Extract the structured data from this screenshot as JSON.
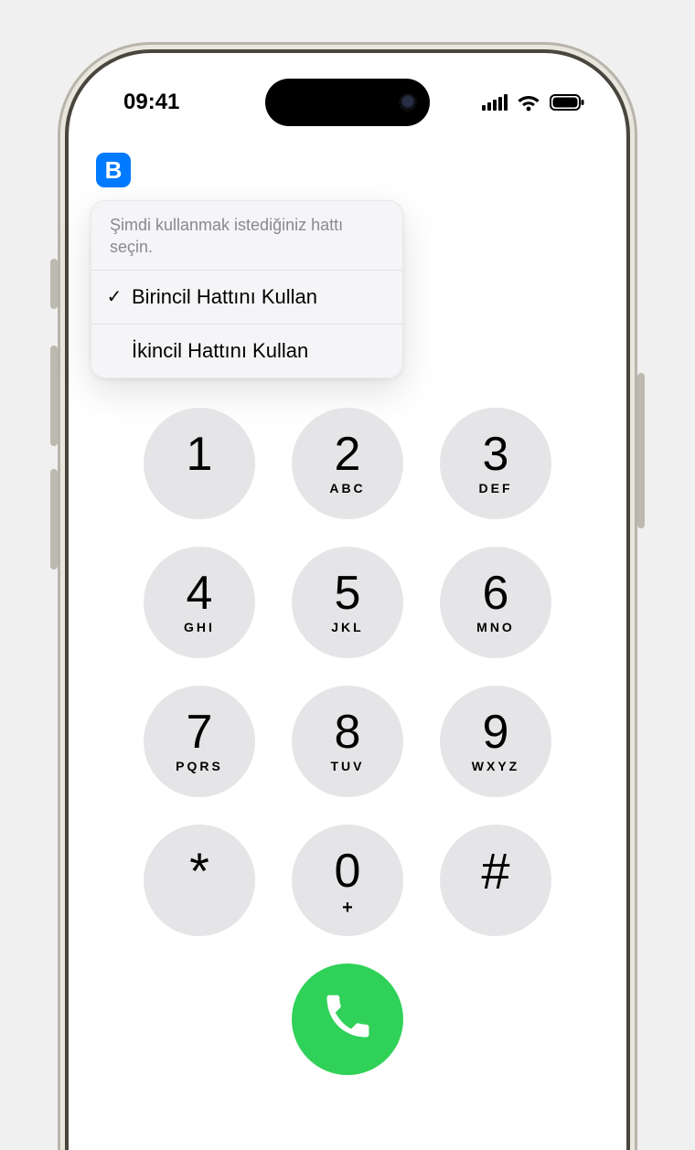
{
  "status": {
    "time": "09:41"
  },
  "lineBadge": "B",
  "popover": {
    "header": "Şimdi kullanmak istediğiniz hattı seçin.",
    "options": [
      {
        "label": "Birincil Hattını Kullan",
        "selected": true
      },
      {
        "label": "İkincil Hattını Kullan",
        "selected": false
      }
    ]
  },
  "keypad": [
    {
      "digit": "1",
      "letters": ""
    },
    {
      "digit": "2",
      "letters": "ABC"
    },
    {
      "digit": "3",
      "letters": "DEF"
    },
    {
      "digit": "4",
      "letters": "GHI"
    },
    {
      "digit": "5",
      "letters": "JKL"
    },
    {
      "digit": "6",
      "letters": "MNO"
    },
    {
      "digit": "7",
      "letters": "PQRS"
    },
    {
      "digit": "8",
      "letters": "TUV"
    },
    {
      "digit": "9",
      "letters": "WXYZ"
    },
    {
      "digit": "*",
      "letters": ""
    },
    {
      "digit": "0",
      "letters": "+"
    },
    {
      "digit": "#",
      "letters": ""
    }
  ]
}
